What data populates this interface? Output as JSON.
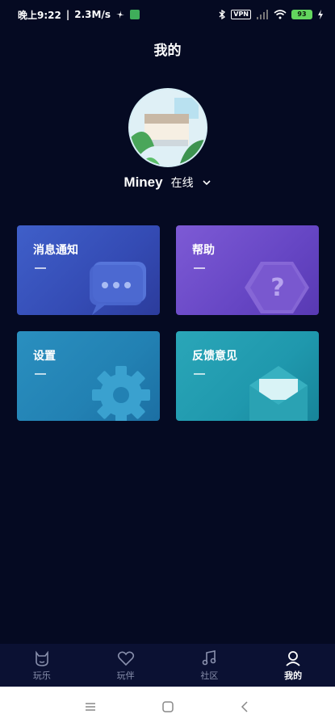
{
  "status_bar": {
    "time": "晚上9:22",
    "speed": "2.3M/s",
    "vpn": "VPN",
    "battery": "93"
  },
  "page": {
    "title": "我的"
  },
  "profile": {
    "username": "Miney",
    "status": "在线"
  },
  "cards": [
    {
      "label": "消息通知"
    },
    {
      "label": "帮助"
    },
    {
      "label": "设置"
    },
    {
      "label": "反馈意见"
    }
  ],
  "tabs": [
    {
      "label": "玩乐"
    },
    {
      "label": "玩伴"
    },
    {
      "label": "社区"
    },
    {
      "label": "我的"
    }
  ],
  "colors": {
    "background": "#050a22",
    "card_notify": "#3f5fc9",
    "card_help": "#7d5ad5",
    "card_settings": "#2a8fbf",
    "card_feedback": "#2aa6b8"
  }
}
